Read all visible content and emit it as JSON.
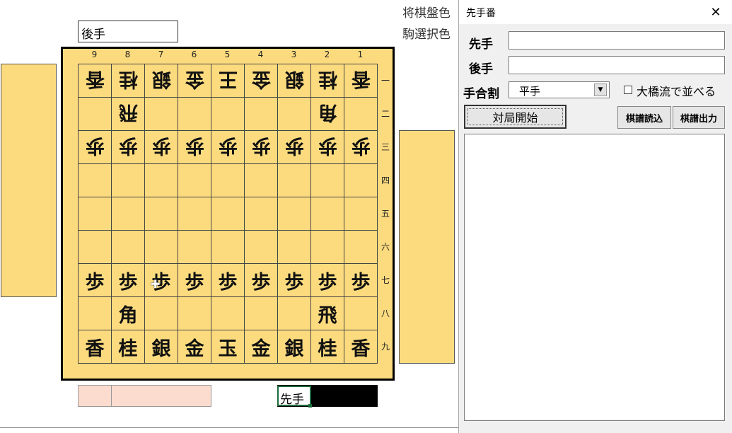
{
  "sheet": {
    "label_board_color": "将棋盤色",
    "label_piece_select_color": "駒選択色",
    "gote_name_box": "後手",
    "turn_label": "先手",
    "column_numbers": [
      "9",
      "8",
      "7",
      "6",
      "5",
      "4",
      "3",
      "2",
      "1"
    ],
    "row_numbers": [
      "一",
      "二",
      "三",
      "四",
      "五",
      "六",
      "七",
      "八",
      "九"
    ],
    "board": [
      [
        {
          "p": "香",
          "g": true
        },
        {
          "p": "桂",
          "g": true
        },
        {
          "p": "銀",
          "g": true
        },
        {
          "p": "金",
          "g": true
        },
        {
          "p": "王",
          "g": true
        },
        {
          "p": "金",
          "g": true
        },
        {
          "p": "銀",
          "g": true
        },
        {
          "p": "桂",
          "g": true
        },
        {
          "p": "香",
          "g": true
        }
      ],
      [
        {
          "p": "",
          "g": false
        },
        {
          "p": "飛",
          "g": true
        },
        {
          "p": "",
          "g": false
        },
        {
          "p": "",
          "g": false
        },
        {
          "p": "",
          "g": false
        },
        {
          "p": "",
          "g": false
        },
        {
          "p": "",
          "g": false
        },
        {
          "p": "角",
          "g": true
        },
        {
          "p": "",
          "g": false
        }
      ],
      [
        {
          "p": "歩",
          "g": true
        },
        {
          "p": "歩",
          "g": true
        },
        {
          "p": "歩",
          "g": true
        },
        {
          "p": "歩",
          "g": true
        },
        {
          "p": "歩",
          "g": true
        },
        {
          "p": "歩",
          "g": true
        },
        {
          "p": "歩",
          "g": true
        },
        {
          "p": "歩",
          "g": true
        },
        {
          "p": "歩",
          "g": true
        }
      ],
      [
        {
          "p": "",
          "g": false
        },
        {
          "p": "",
          "g": false
        },
        {
          "p": "",
          "g": false
        },
        {
          "p": "",
          "g": false
        },
        {
          "p": "",
          "g": false
        },
        {
          "p": "",
          "g": false
        },
        {
          "p": "",
          "g": false
        },
        {
          "p": "",
          "g": false
        },
        {
          "p": "",
          "g": false
        }
      ],
      [
        {
          "p": "",
          "g": false
        },
        {
          "p": "",
          "g": false
        },
        {
          "p": "",
          "g": false
        },
        {
          "p": "",
          "g": false
        },
        {
          "p": "",
          "g": false
        },
        {
          "p": "",
          "g": false
        },
        {
          "p": "",
          "g": false
        },
        {
          "p": "",
          "g": false
        },
        {
          "p": "",
          "g": false
        }
      ],
      [
        {
          "p": "",
          "g": false
        },
        {
          "p": "",
          "g": false
        },
        {
          "p": "",
          "g": false
        },
        {
          "p": "",
          "g": false
        },
        {
          "p": "",
          "g": false
        },
        {
          "p": "",
          "g": false
        },
        {
          "p": "",
          "g": false
        },
        {
          "p": "",
          "g": false
        },
        {
          "p": "",
          "g": false
        }
      ],
      [
        {
          "p": "歩",
          "g": false
        },
        {
          "p": "歩",
          "g": false
        },
        {
          "p": "歩",
          "g": false
        },
        {
          "p": "歩",
          "g": false
        },
        {
          "p": "歩",
          "g": false
        },
        {
          "p": "歩",
          "g": false
        },
        {
          "p": "歩",
          "g": false
        },
        {
          "p": "歩",
          "g": false
        },
        {
          "p": "歩",
          "g": false
        }
      ],
      [
        {
          "p": "",
          "g": false
        },
        {
          "p": "角",
          "g": false
        },
        {
          "p": "",
          "g": false
        },
        {
          "p": "",
          "g": false
        },
        {
          "p": "",
          "g": false
        },
        {
          "p": "",
          "g": false
        },
        {
          "p": "",
          "g": false
        },
        {
          "p": "飛",
          "g": false
        },
        {
          "p": "",
          "g": false
        }
      ],
      [
        {
          "p": "香",
          "g": false
        },
        {
          "p": "桂",
          "g": false
        },
        {
          "p": "銀",
          "g": false
        },
        {
          "p": "金",
          "g": false
        },
        {
          "p": "玉",
          "g": false
        },
        {
          "p": "金",
          "g": false
        },
        {
          "p": "銀",
          "g": false
        },
        {
          "p": "桂",
          "g": false
        },
        {
          "p": "香",
          "g": false
        }
      ]
    ]
  },
  "dialog": {
    "title": "先手番",
    "close_glyph": "✕",
    "sente_label": "先手",
    "sente_value": "",
    "gote_label": "後手",
    "gote_value": "",
    "handicap_label": "手合割",
    "handicap_selected": "平手",
    "ohashi_label": "大橋流で並べる",
    "ohashi_checked": false,
    "start_button": "対局開始",
    "load_button": "棋譜読込",
    "export_button": "棋譜出力"
  },
  "colors": {
    "board": "#fcdb7f",
    "hand_area": "#fcdb7f",
    "timer_area": "#fbdccf",
    "selection_border": "#1e6b3c"
  },
  "icons": {
    "close": "close-icon",
    "dropdown": "chevron-down-icon",
    "cursor": "cross-cursor-icon"
  }
}
